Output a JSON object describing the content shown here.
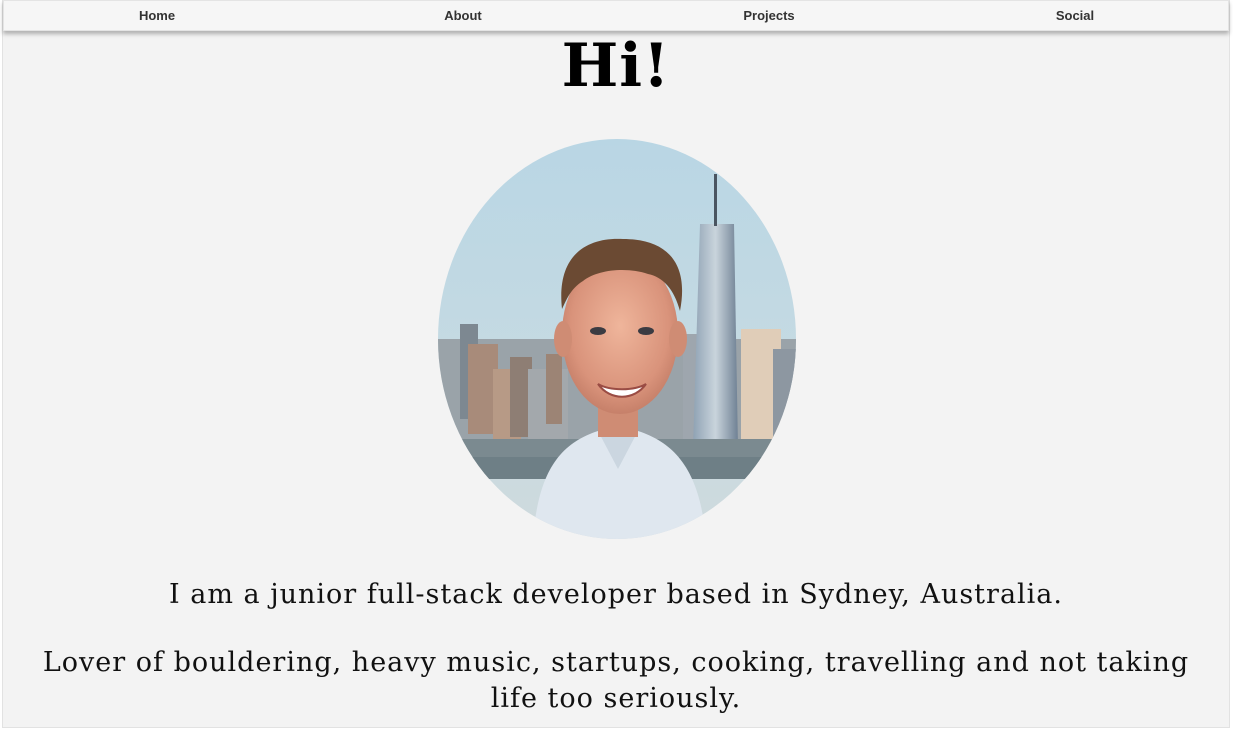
{
  "nav": {
    "items": [
      {
        "label": "Home"
      },
      {
        "label": "About"
      },
      {
        "label": "Projects"
      },
      {
        "label": "Social"
      }
    ]
  },
  "hero": {
    "title": "Hi!",
    "intro": "I am a junior full-stack developer based in Sydney, Australia.",
    "hobbies": "Lover of bouldering, heavy music, startups, cooking, travelling and not taking life too seriously."
  },
  "colors": {
    "page_background": "#f3f3f3",
    "navbar_background": "#f6f6f6",
    "nav_text": "#333333",
    "body_text": "#111111"
  }
}
